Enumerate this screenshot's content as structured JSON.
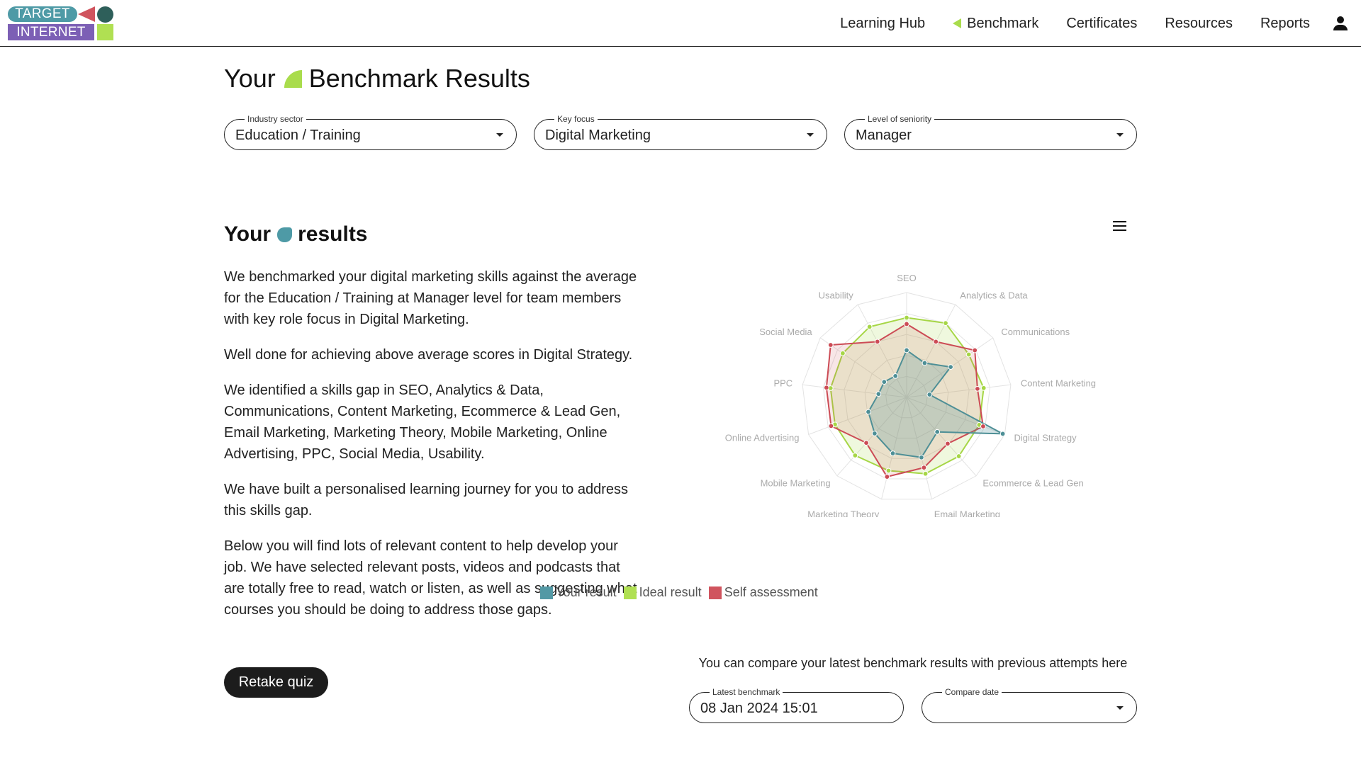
{
  "header": {
    "logo": {
      "line1": "TARGET",
      "line2": "INTERNET",
      "colors": {
        "teal": "#4e9aa6",
        "red": "#d0545e",
        "dark_teal": "#2e5f5a",
        "purple": "#7c5fb5",
        "green": "#b0e052"
      }
    },
    "nav": [
      {
        "label": "Learning Hub",
        "active": false
      },
      {
        "label": "Benchmark",
        "active": true
      },
      {
        "label": "Certificates",
        "active": false
      },
      {
        "label": "Resources",
        "active": false
      },
      {
        "label": "Reports",
        "active": false
      }
    ],
    "user_icon": "person-icon"
  },
  "page": {
    "title_prefix": "Your",
    "title_suffix": "Benchmark Results"
  },
  "filters": {
    "industry": {
      "label": "Industry sector",
      "value": "Education / Training"
    },
    "focus": {
      "label": "Key focus",
      "value": "Digital Marketing"
    },
    "seniority": {
      "label": "Level of seniority",
      "value": "Manager"
    }
  },
  "results": {
    "title_prefix": "Your",
    "title_suffix": "results",
    "paragraphs": [
      "We benchmarked your digital marketing skills against the average for the Education / Training at Manager level for team members with key role focus in Digital Marketing.",
      "Well done for achieving above average scores in Digital Strategy.",
      "We identified a skills gap in SEO, Analytics & Data, Communications, Content Marketing, Ecommerce & Lead Gen, Email Marketing, Marketing Theory, Mobile Marketing, Online Advertising, PPC, Social Media, Usability.",
      "We have built a personalised learning journey for you to address this skills gap.",
      "Below you will find lots of relevant content to help develop your job. We have selected relevant posts, videos and podcasts that are totally free to read, watch or listen, as well as suggesting what courses you should be doing to address those gaps."
    ],
    "retake_label": "Retake quiz"
  },
  "chart_menu_icon": "hamburger-menu-icon",
  "chart_data": {
    "type": "radar",
    "title": "",
    "categories": [
      "SEO",
      "Analytics & Data",
      "Communications",
      "Content Marketing",
      "Digital Strategy",
      "Ecommerce & Lead Gen",
      "Email Marketing",
      "Marketing Theory",
      "Mobile Marketing",
      "Online Advertising",
      "PPC",
      "Social Media",
      "Usability"
    ],
    "range": [
      0,
      5
    ],
    "rings": 5,
    "grid": true,
    "legend_position": "bottom",
    "series": [
      {
        "name": "Your result",
        "color": "#4e8f96",
        "legend_color": "#5399a5",
        "values": [
          2.25,
          1.85,
          2.55,
          1.1,
          4.9,
          2.2,
          2.95,
          2.75,
          2.3,
          1.95,
          1.35,
          1.3,
          1.15
        ]
      },
      {
        "name": "Ideal result",
        "color": "#a6d646",
        "legend_color": "#b0e052",
        "values": [
          3.8,
          4.0,
          3.6,
          3.7,
          3.7,
          3.75,
          3.75,
          3.6,
          3.7,
          3.65,
          3.65,
          3.7,
          3.8
        ]
      },
      {
        "name": "Self assessment",
        "color": "#cc4b55",
        "legend_color": "#d0545e",
        "values": [
          3.5,
          3.0,
          3.95,
          3.4,
          3.9,
          2.95,
          3.45,
          3.9,
          2.9,
          3.85,
          3.85,
          4.4,
          3.0
        ]
      }
    ]
  },
  "compare": {
    "text": "You can compare your latest benchmark results with previous attempts here",
    "latest": {
      "label": "Latest benchmark",
      "value": "08 Jan 2024 15:01"
    },
    "compare_date": {
      "label": "Compare date",
      "value": ""
    }
  }
}
